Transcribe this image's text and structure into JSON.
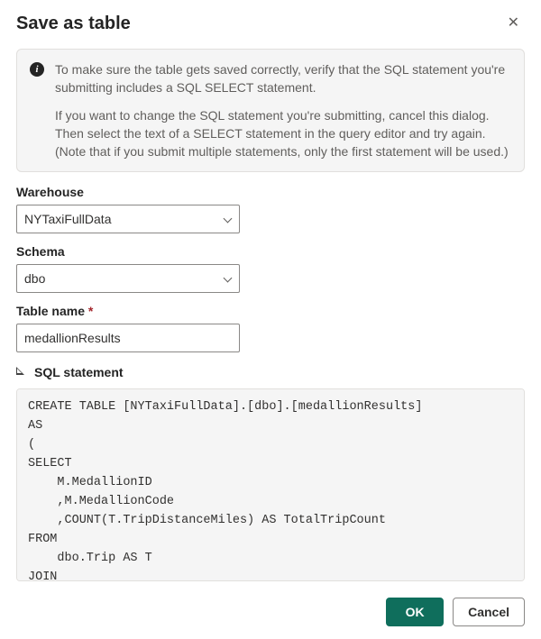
{
  "dialog": {
    "title": "Save as table",
    "info_p1": "To make sure the table gets saved correctly, verify that the SQL statement you're submitting includes a SQL SELECT statement.",
    "info_p2": "If you want to change the SQL statement you're submitting, cancel this dialog. Then select the text of a SELECT statement in the query editor and try again. (Note that if you submit multiple statements, only the first statement will be used.)"
  },
  "fields": {
    "warehouse": {
      "label": "Warehouse",
      "value": "NYTaxiFullData"
    },
    "schema": {
      "label": "Schema",
      "value": "dbo"
    },
    "table": {
      "label": "Table name",
      "required_mark": "*",
      "value": "medallionResults"
    }
  },
  "sql": {
    "section_label": "SQL statement",
    "code": "CREATE TABLE [NYTaxiFullData].[dbo].[medallionResults]\nAS\n(\nSELECT\n    M.MedallionID\n    ,M.MedallionCode\n    ,COUNT(T.TripDistanceMiles) AS TotalTripCount\nFROM\n    dbo.Trip AS T\nJOIN\n"
  },
  "buttons": {
    "ok": "OK",
    "cancel": "Cancel"
  }
}
